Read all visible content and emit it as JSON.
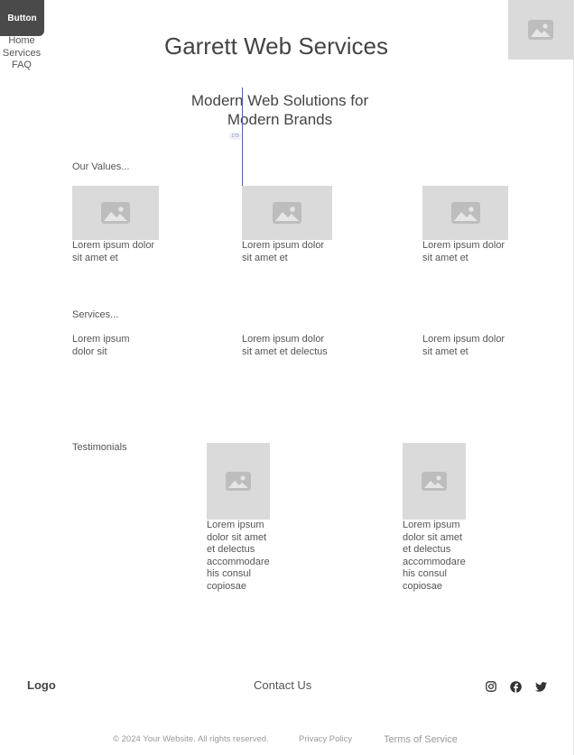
{
  "header": {
    "button_label": "Button",
    "nav": [
      "Home",
      "Services",
      "FAQ"
    ],
    "title": "Garrett Web Services"
  },
  "hero": {
    "subtitle_line1": "Modern Web Solutions for",
    "subtitle_line2": "Modern Brands",
    "cursor_tag": "173"
  },
  "values": {
    "heading": "Our Values...",
    "cards": [
      {
        "text": "Lorem ipsum dolor sit amet et",
        "icon": "image-icon"
      },
      {
        "text": "Lorem ipsum dolor sit amet et",
        "icon": "image-icon"
      },
      {
        "text": "Lorem ipsum dolor sit amet et",
        "icon": "image-icon"
      }
    ]
  },
  "services": {
    "heading": "Services...",
    "items": [
      "Lorem ipsum dolor sit",
      "Lorem ipsum dolor sit amet et delectus",
      "Lorem ipsum dolor sit amet et"
    ]
  },
  "testimonials": {
    "heading": "Testimonials",
    "items": [
      {
        "text": "Lorem ipsum dolor sit amet et delectus accommodare his consul copiosae",
        "icon": "image-icon"
      },
      {
        "text": "Lorem ipsum dolor sit amet et delectus accommodare his consul copiosae",
        "icon": "image-icon"
      }
    ]
  },
  "footer": {
    "logo": "Logo",
    "contact": "Contact Us",
    "social_icons": [
      "instagram-icon",
      "facebook-icon",
      "twitter-icon"
    ],
    "copyright": "© 2024 Your Website. All rights reserved.",
    "privacy": "Privacy Policy",
    "terms": "Terms of Service"
  },
  "colors": {
    "button_bg": "#4a4a4a",
    "placeholder_bg": "#dadada",
    "text": "#444444",
    "muted": "#999999"
  }
}
